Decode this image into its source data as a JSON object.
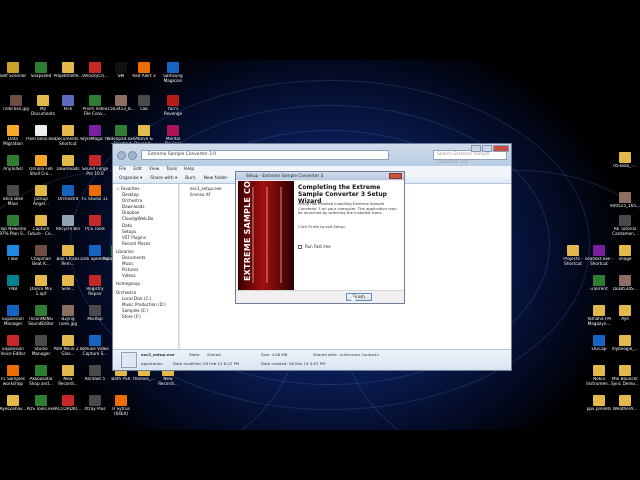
{
  "desktop": {
    "icons": [
      {
        "label": "Self Scenner",
        "color": "#c9a227"
      },
      {
        "label": "Snapseed",
        "color": "#2e7d32"
      },
      {
        "label": "Projekthelfe...",
        "color": "#e3b94c"
      },
      {
        "label": "VelocityCh...",
        "color": "#c62828"
      },
      {
        "label": "SM",
        "color": "#111111"
      },
      {
        "label": "Rad Alert 3",
        "color": "#ef6c00"
      },
      {
        "label": "Samsung Magician",
        "color": "#1565c0"
      },
      {
        "label": "r2I6F0se.jpg",
        "color": "#6d4c41"
      },
      {
        "label": "My Documents",
        "color": "#e3b94c"
      },
      {
        "label": "Pick",
        "color": "#5c6bc0"
      },
      {
        "label": "Prism Video File Conv...",
        "color": "#2e7d32"
      },
      {
        "label": "1503413_8...",
        "color": "#8d6e63"
      },
      {
        "label": "Lab",
        "color": "#4a4a4a"
      },
      {
        "label": "Yuri's Revenge",
        "color": "#b71c1c"
      },
      {
        "label": "Data Migration",
        "color": "#f9a825"
      },
      {
        "label": "Pixel benz.exe",
        "color": "#eeeeee"
      },
      {
        "label": "Documents - Shortcut",
        "color": "#e3b94c"
      },
      {
        "label": "StyleMagic YA",
        "color": "#7b1fa2"
      },
      {
        "label": "videopad.exe - Shortcut",
        "color": "#2e7d32"
      },
      {
        "label": "Above & Beyond...",
        "color": "#e3b94c"
      },
      {
        "label": "Mental Devices",
        "color": "#ad1457"
      },
      {
        "label": "AnyToISO",
        "color": "#2e7d32"
      },
      {
        "label": "Orkiola Feb Shell Cro...",
        "color": "#f9a825"
      },
      {
        "label": "Downloads",
        "color": "#e3b94c"
      },
      {
        "label": "Sound Forge Pro 10.0",
        "color": "#c62828"
      },
      {
        "label": "Stick Bike Mass",
        "color": "#4a4a4a"
      },
      {
        "label": "Jackup Angel...",
        "color": "#e3b94c"
      },
      {
        "label": "Orchestra",
        "color": "#1565c0"
      },
      {
        "label": "FL Studio 11",
        "color": "#ef6c00"
      },
      {
        "label": "Top Newsmo 97% Plan S...",
        "color": "#2e7d32"
      },
      {
        "label": "Capture Future - Co...",
        "color": "#e3b94c"
      },
      {
        "label": "Recycle Bin",
        "color": "#90a4ae"
      },
      {
        "label": "PCS Tools",
        "color": "#c62828"
      },
      {
        "label": "Flow",
        "color": "#1e88e5"
      },
      {
        "label": "Chapman Beat K...",
        "color": "#6d4c41"
      },
      {
        "label": "Bad Chicks Rem...",
        "color": "#e3b94c"
      },
      {
        "label": "Disk SpeedUp",
        "color": "#1565c0"
      },
      {
        "label": "Avsara Studio",
        "color": "#2e7d32"
      },
      {
        "label": "FNB",
        "color": "#00838f"
      },
      {
        "label": "Dance Mix 1.apf",
        "color": "#e3b94c"
      },
      {
        "label": "Sele...",
        "color": "#e3b94c"
      },
      {
        "label": "Registry Repair",
        "color": "#c62828"
      },
      {
        "label": "Expansion Manager",
        "color": "#1565c0"
      },
      {
        "label": "recordKING SoundEditor",
        "color": "#2e7d32"
      },
      {
        "label": "B2jing rules.jpg",
        "color": "#8d6e63"
      },
      {
        "label": "MixRap",
        "color": "#4a4a4a"
      },
      {
        "label": "Expansion Voice Editor",
        "color": "#c62828"
      },
      {
        "label": "Studio Manager",
        "color": "#4a4a4a"
      },
      {
        "label": "Pahl Neue 2.0 Glos...",
        "color": "#e3b94c"
      },
      {
        "label": "Deluxe Video Capture S...",
        "color": "#1565c0"
      },
      {
        "label": "FL Samples workshop",
        "color": "#ef6c00"
      },
      {
        "label": "Akkoosotia Shop and...",
        "color": "#2e7d32"
      },
      {
        "label": "New Recordi...",
        "color": "#e3b94c"
      },
      {
        "label": "Kontakt 5",
        "color": "#4a4a4a"
      },
      {
        "label": "Bath PSR",
        "color": "#e3b94c"
      },
      {
        "label": "themes_...",
        "color": "#e3b94c"
      },
      {
        "label": "New Recordi...",
        "color": "#e3b94c"
      },
      {
        "label": "AyesZehav...",
        "color": "#e3b94c"
      },
      {
        "label": "PDS Tools.exe",
        "color": "#2e7d32"
      },
      {
        "label": "ACCORDIO...",
        "color": "#c62828"
      },
      {
        "label": "Xtray Plus",
        "color": "#4a4a4a"
      },
      {
        "label": "R Sytrus (64bit)",
        "color": "#ef6c00"
      },
      {
        "label": "05-Bola_-...",
        "color": "#e3b94c"
      },
      {
        "label": "940515_165...",
        "color": "#8d6e63"
      },
      {
        "label": "RE Tutorial Cantamen...",
        "color": "#4a4a4a"
      },
      {
        "label": "image",
        "color": "#e3b94c"
      },
      {
        "label": "Projects - Shortcut",
        "color": "#e3b94c"
      },
      {
        "label": "seahost.exe - Shortcut",
        "color": "#7b1fa2"
      },
      {
        "label": "uTorrent",
        "color": "#2e7d32"
      },
      {
        "label": "1838534S...",
        "color": "#8d6e63"
      },
      {
        "label": "Yamaha FM Magazyn...",
        "color": "#e3b94c"
      },
      {
        "label": "Ayll",
        "color": "#e3b94c"
      },
      {
        "label": "LIGCap",
        "color": "#1565c0"
      },
      {
        "label": "myboogie_...",
        "color": "#e3b94c"
      },
      {
        "label": "Nokia Instrumen...",
        "color": "#e3b94c"
      },
      {
        "label": "Mix Bouncer Sync Demo...",
        "color": "#e3b94c"
      },
      {
        "label": "ppx presets",
        "color": "#e3b94c"
      },
      {
        "label": "WeatherA...",
        "color": "#e3b94c"
      },
      {
        "label": "My Downloads",
        "color": "#e3b94c"
      },
      {
        "label": "Temp - Shortcut",
        "color": "#e3b94c"
      },
      {
        "label": "_Activate",
        "color": "#e3b94c"
      }
    ]
  },
  "explorer": {
    "address": "Extreme Sample Converter 3.0",
    "search_placeholder": "Search Extreme Sample Converter 3.0",
    "menu": [
      "File",
      "Edit",
      "View",
      "Tools",
      "Help"
    ],
    "toolbar": [
      "Organize ▾",
      "Share with ▾",
      "Burn",
      "New folder"
    ],
    "nav": [
      {
        "label": "☆ Favorites",
        "header": true
      },
      {
        "label": "Desktop"
      },
      {
        "label": "Orchestra"
      },
      {
        "label": "Downloads"
      },
      {
        "label": "Dropbox"
      },
      {
        "label": "Cloud@Web.Bo"
      },
      {
        "label": "Data"
      },
      {
        "label": "Setups"
      },
      {
        "label": "VST Plugins"
      },
      {
        "label": "Recent Places"
      },
      {
        "label": "Libraries",
        "header": true
      },
      {
        "label": "Documents"
      },
      {
        "label": "Music"
      },
      {
        "label": "Pictures"
      },
      {
        "label": "Videos"
      },
      {
        "label": "Homegroup",
        "header": true
      },
      {
        "label": "Orchestra",
        "header": true
      },
      {
        "label": "Local Disk (C:)"
      },
      {
        "label": "Music Production (D:)"
      },
      {
        "label": "Samples (E:)"
      },
      {
        "label": "Store (F:)"
      }
    ],
    "files": [
      "esc3_setup.exe",
      "license.rtf"
    ],
    "details": {
      "name": "esc3_setup.exe",
      "type": "Application",
      "state_label": "State:",
      "state_value": "Shared",
      "date_modified": "Date modified: 09 Feb 12 8:22 PM",
      "size": "Size: 4.88 MB",
      "date_created": "Date created: 26 Mar 14 5:07 PM",
      "shared_with": "Shared with: <Unknown Contact>"
    }
  },
  "setup": {
    "title": "Setup - Extreme Sample Converter 3",
    "banner_text": "EXTREME SAMPLE CONVERTER",
    "heading": "Completing the Extreme Sample Converter 3 Setup Wizard",
    "body": "Setup has finished installing Extreme Sample Converter 3 on your computer. The application may be launched by selecting the installed icons.",
    "instruction": "Click Finish to exit Setup.",
    "checkbox_label": "Run Fast ime",
    "finish_label": "Finish"
  }
}
